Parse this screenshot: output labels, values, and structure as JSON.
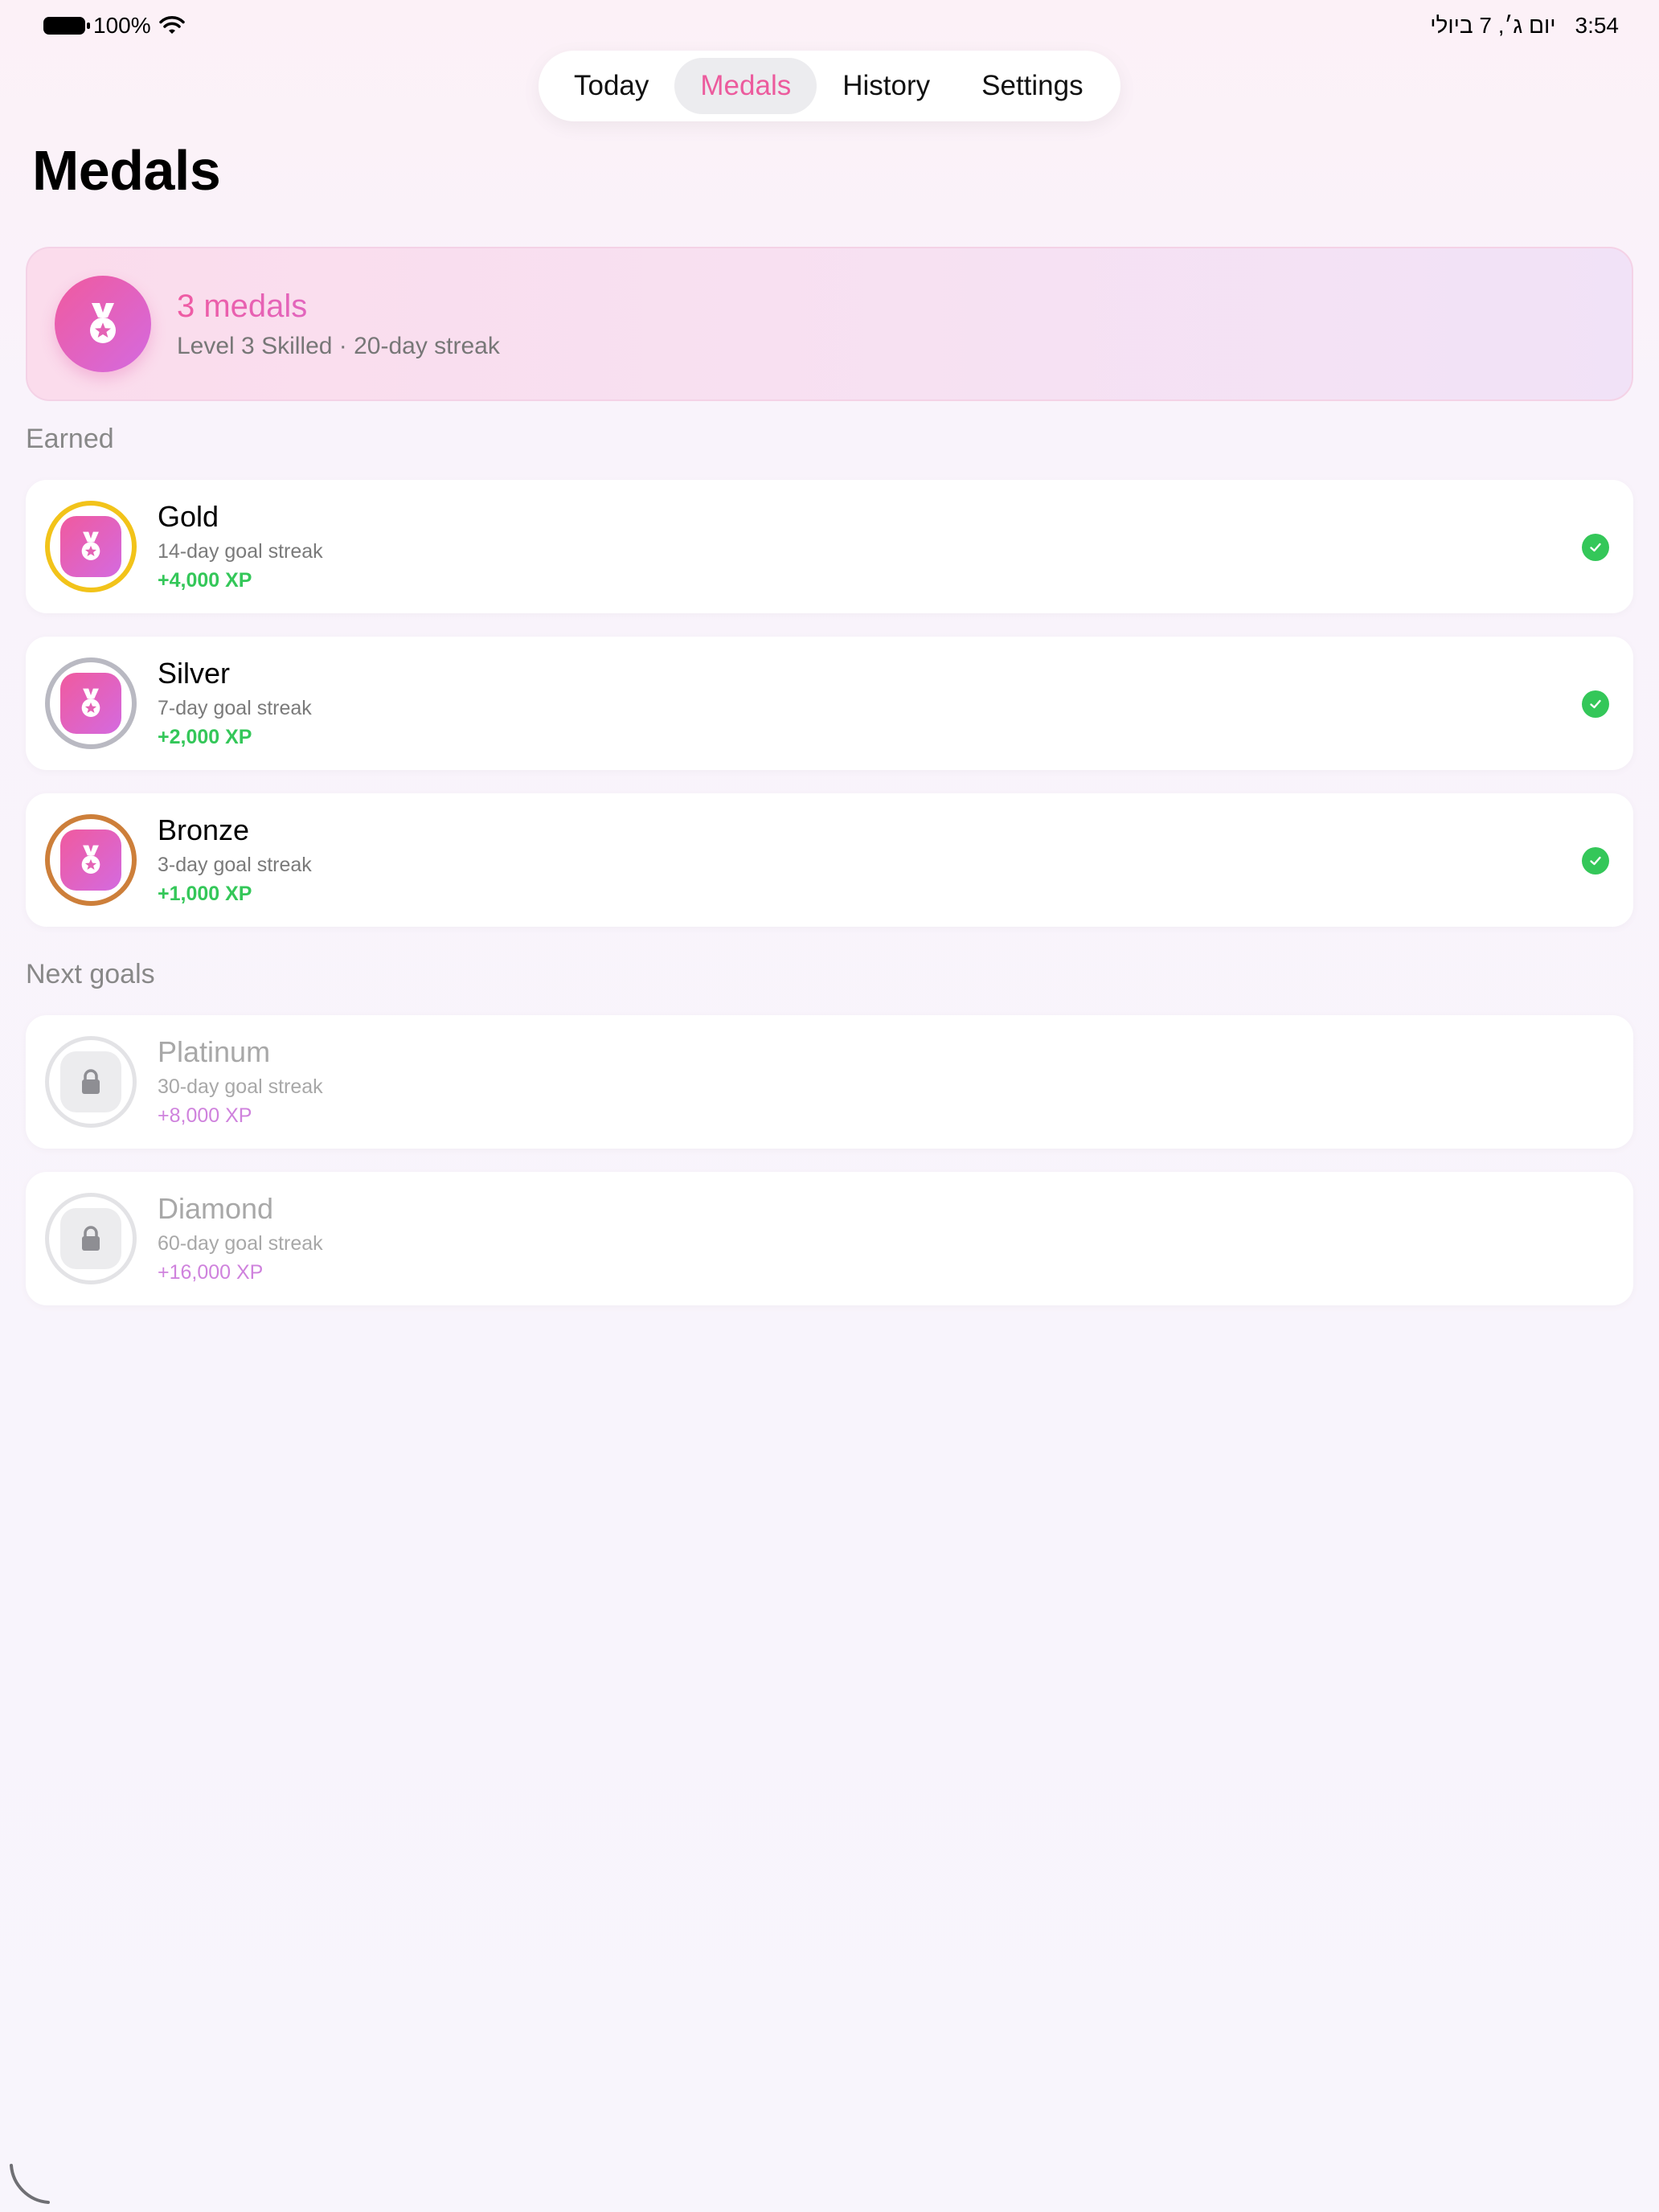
{
  "status_bar": {
    "battery": "100%",
    "date": "יום ג׳, 7 ביולי",
    "time": "3:54"
  },
  "tabs": [
    {
      "label": "Today",
      "active": false
    },
    {
      "label": "Medals",
      "active": true
    },
    {
      "label": "History",
      "active": false
    },
    {
      "label": "Settings",
      "active": false
    }
  ],
  "page_title": "Medals",
  "summary": {
    "count": "3 medals",
    "subtitle": "Level 3 Skilled · 20-day streak",
    "icon": "medal-icon"
  },
  "earned": {
    "label": "Earned",
    "items": [
      {
        "title": "Gold",
        "desc": "14-day goal streak",
        "xp": "+4,000 XP",
        "ring_color": "#f2c31a",
        "icon": "medal-icon",
        "status_icon": "checkmark-icon"
      },
      {
        "title": "Silver",
        "desc": "7-day goal streak",
        "xp": "+2,000 XP",
        "ring_color": "#b9b9c2",
        "icon": "medal-icon",
        "status_icon": "checkmark-icon"
      },
      {
        "title": "Bronze",
        "desc": "3-day goal streak",
        "xp": "+1,000 XP",
        "ring_color": "#cd7f3a",
        "icon": "medal-icon",
        "status_icon": "checkmark-icon"
      }
    ]
  },
  "next_goals": {
    "label": "Next goals",
    "items": [
      {
        "title": "Platinum",
        "desc": "30-day goal streak",
        "xp": "+8,000 XP",
        "ring_color": "#e3e3e6",
        "icon": "lock-icon"
      },
      {
        "title": "Diamond",
        "desc": "60-day goal streak",
        "xp": "+16,000 XP",
        "ring_color": "#e3e3e6",
        "icon": "lock-icon"
      }
    ]
  },
  "colors": {
    "accent_pink": "#ec5b9d",
    "accent_purple": "#d46ae0",
    "success_green": "#34c759"
  }
}
